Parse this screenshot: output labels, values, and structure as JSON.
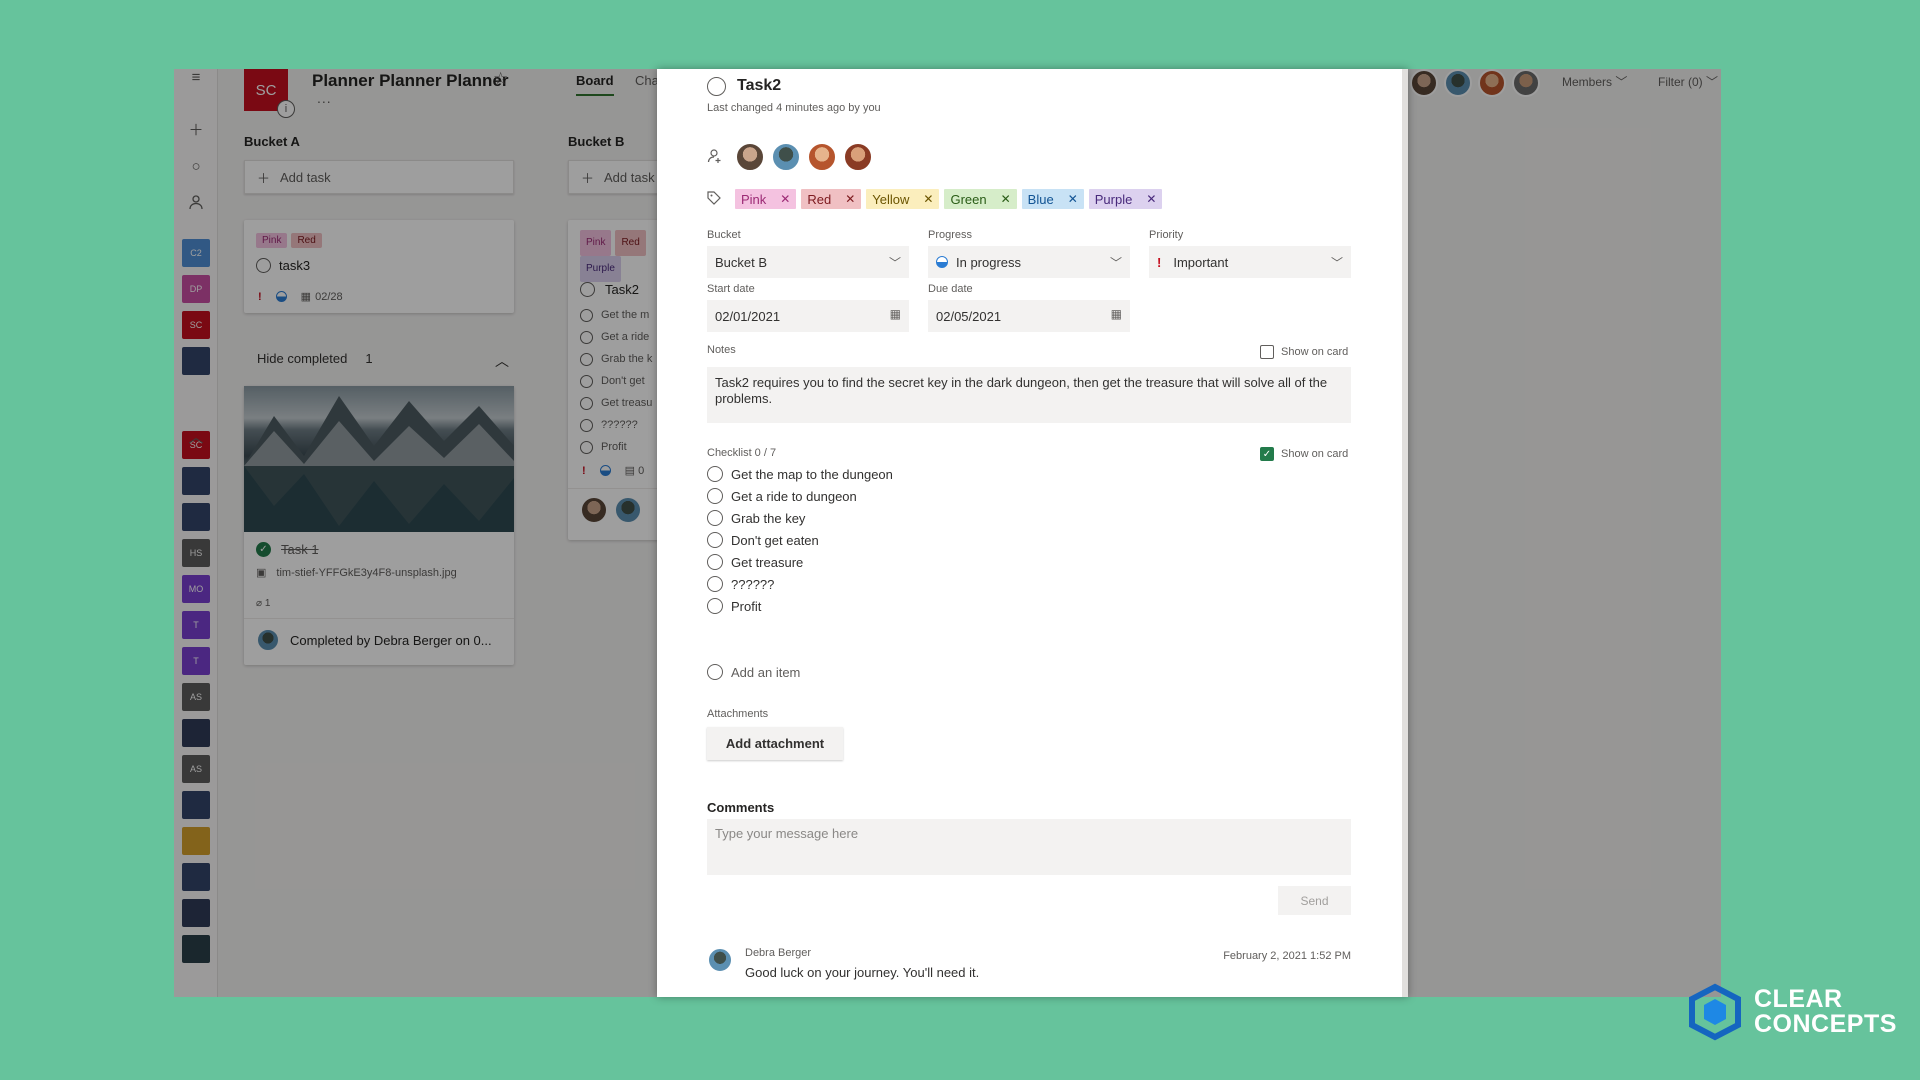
{
  "plan": {
    "logo": "SC",
    "title": "Planner Planner Planner",
    "more": "...",
    "info": "i"
  },
  "tabs": {
    "board": "Board",
    "charts": "Cha"
  },
  "header": {
    "members": "Members",
    "filter": "Filter (0)"
  },
  "rail": {
    "tiles": [
      {
        "text": "C2",
        "color": "#4f8fd6"
      },
      {
        "text": "DP",
        "color": "#c94ea3"
      },
      {
        "text": "SC",
        "color": "#c50f1f"
      },
      {
        "text": "",
        "color": "#33456a"
      },
      {
        "text": "SC",
        "color": "#c50f1f"
      },
      {
        "text": "",
        "color": "#33456a"
      },
      {
        "text": "",
        "color": "#33456a"
      },
      {
        "text": "HS",
        "color": "#5c5c5c"
      },
      {
        "text": "MO",
        "color": "#7a3fd0"
      },
      {
        "text": "T",
        "color": "#7a3fd0"
      },
      {
        "text": "T",
        "color": "#7a3fd0"
      },
      {
        "text": "AS",
        "color": "#5c5c5c"
      },
      {
        "text": "",
        "color": "#2f3a57"
      },
      {
        "text": "AS",
        "color": "#5c5c5c"
      },
      {
        "text": "",
        "color": "#33456a"
      },
      {
        "text": "",
        "color": "#d3a12d"
      },
      {
        "text": "",
        "color": "#33456a"
      },
      {
        "text": "",
        "color": "#2f3a57"
      },
      {
        "text": "",
        "color": "#2b3f4a"
      }
    ]
  },
  "bucket_a": {
    "title": "Bucket A",
    "add_task": "Add task",
    "card1": {
      "labels": [
        "Pink",
        "Red"
      ],
      "title": "task3",
      "priority": "!",
      "date": "02/28"
    },
    "hide_completed": "Hide completed",
    "completed_count": "1",
    "card2": {
      "title": "Task 1",
      "attachment": "tim-stief-YFFGkE3y4F8-unsplash.jpg",
      "attach_count": "1",
      "completed_by": "Completed by Debra Berger on 0..."
    }
  },
  "bucket_b": {
    "title": "Bucket B",
    "add_task": "Add task",
    "labels": [
      "Pink",
      "Red",
      "Purple"
    ],
    "task_title": "Task2",
    "checklist": [
      "Get the m",
      "Get a ride",
      "Grab the k",
      "Don't get",
      "Get treasu",
      "??????",
      "Profit"
    ],
    "count": "0"
  },
  "task": {
    "title": "Task2",
    "last_changed": "Last changed 4 minutes ago by you",
    "labels": [
      {
        "name": "Pink",
        "bg": "#f4c2e0",
        "fg": "#9c2a75"
      },
      {
        "name": "Red",
        "bg": "#f0c0c3",
        "fg": "#7d1a1f"
      },
      {
        "name": "Yellow",
        "bg": "#fbeebd",
        "fg": "#6b5400"
      },
      {
        "name": "Green",
        "bg": "#d6edc9",
        "fg": "#295c16"
      },
      {
        "name": "Blue",
        "bg": "#c8e2f5",
        "fg": "#125494"
      },
      {
        "name": "Purple",
        "bg": "#dcd1ef",
        "fg": "#48297b"
      }
    ],
    "bucket_label": "Bucket",
    "bucket_value": "Bucket B",
    "progress_label": "Progress",
    "progress_value": "In progress",
    "priority_label": "Priority",
    "priority_value": "Important",
    "priority_mark": "!",
    "start_label": "Start date",
    "start_value": "02/01/2021",
    "due_label": "Due date",
    "due_value": "02/05/2021",
    "notes_label": "Notes",
    "notes_show": "Show on card",
    "notes_text": "Task2 requires you to find the secret key in the dark dungeon, then get the treasure that will solve all of the problems.",
    "checklist_label": "Checklist 0 / 7",
    "checklist_show": "Show on card",
    "checklist": [
      "Get the map to the dungeon",
      "Get a ride to dungeon",
      "Grab the key",
      "Don't get eaten",
      "Get treasure",
      "??????",
      "Profit"
    ],
    "add_item": "Add an item",
    "attachments_label": "Attachments",
    "add_attachment": "Add attachment",
    "comments_label": "Comments",
    "comment_placeholder": "Type your message here",
    "send": "Send",
    "comment": {
      "author": "Debra Berger",
      "date": "February 2, 2021 1:52 PM",
      "text": "Good luck on your journey. You'll need it."
    }
  },
  "brand": {
    "line1": "CLEAR",
    "line2": "CONCEPTS"
  }
}
